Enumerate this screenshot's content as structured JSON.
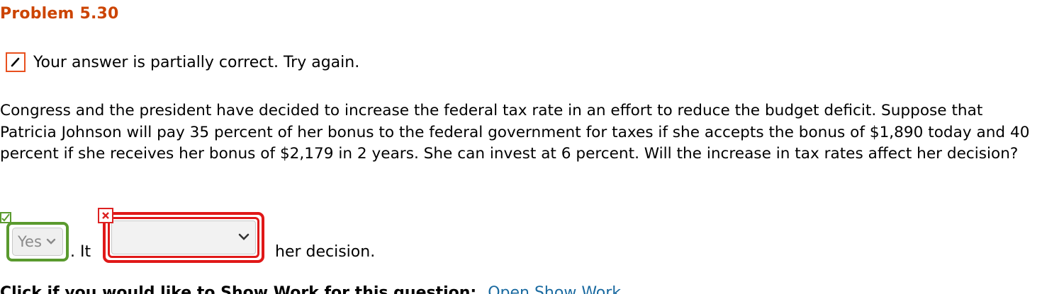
{
  "problem": {
    "title": "Problem 5.30"
  },
  "status": {
    "icon": "pencil-icon",
    "message": "Your answer is partially correct.  Try again.",
    "accent_color": "#e8501e"
  },
  "question": {
    "text": "Congress and the president have decided to increase the federal tax rate in an effort to reduce the budget deficit. Suppose that Patricia Johnson will pay 35 percent of her bonus to the federal government for taxes if she accepts the bonus of $1,890 today and 40 percent if she receives her bonus of $2,179 in 2 years. She can invest at 6 percent. Will the increase in tax rates affect her decision?"
  },
  "answer": {
    "first_select": {
      "selected": "Yes",
      "state": "correct",
      "color": "#5a9a2e"
    },
    "connector_text": ". It",
    "second_select": {
      "selected": "",
      "state": "incorrect",
      "color": "#e01818"
    },
    "trailing_text": "her decision."
  },
  "footer": {
    "prompt_partial": "Click if you would like to Show Work for this question:",
    "link_partial": "Open Show Work"
  }
}
